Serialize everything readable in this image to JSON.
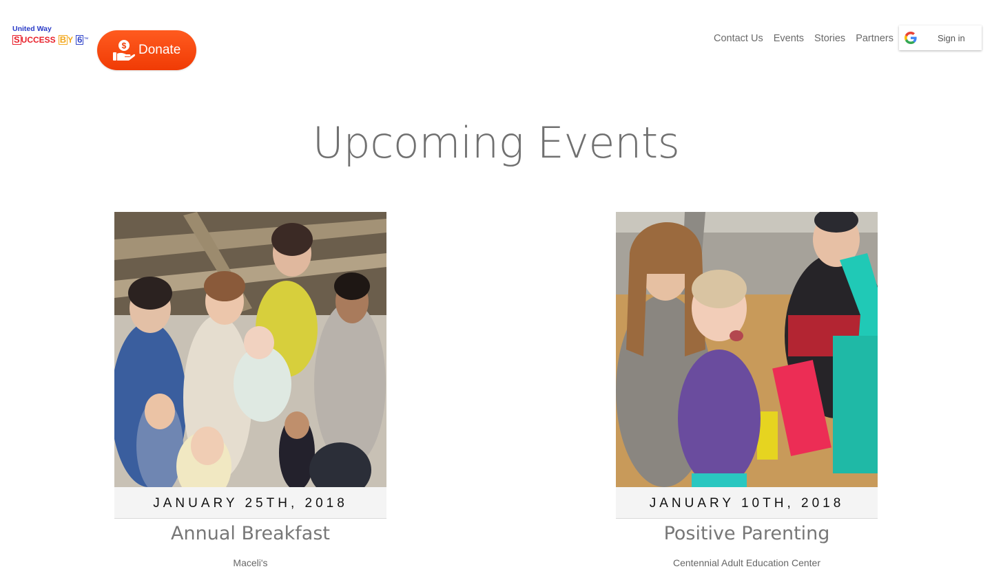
{
  "header": {
    "logo": {
      "top_text": "United Way",
      "s": "S",
      "ucess": "UCCESS",
      "b": "B",
      "y": "Y",
      "six": "6",
      "tm": "™"
    },
    "donate_label": "Donate",
    "nav": [
      "Contact Us",
      "Events",
      "Stories",
      "Partners"
    ],
    "signin_label": "Sign in"
  },
  "page_title": "Upcoming Events",
  "events": [
    {
      "date": "JANUARY 25TH, 2018",
      "title": "Annual Breakfast",
      "location": "Maceli's"
    },
    {
      "date": "JANUARY 10TH, 2018",
      "title": "Positive Parenting",
      "location": "Centennial Adult Education Center"
    }
  ],
  "colors": {
    "donate": "#f23f08",
    "title": "#707070",
    "date_band": "#f4f4f4"
  },
  "icons": [
    "donate-hand-coin-icon",
    "google-g-icon"
  ]
}
